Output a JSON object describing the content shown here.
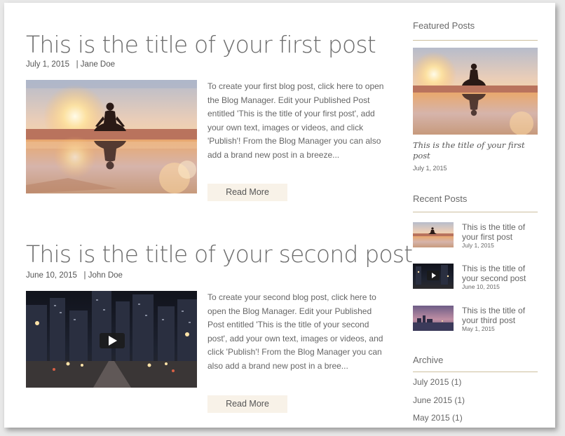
{
  "posts": [
    {
      "title": "This is the title of your first post",
      "date": "July 1, 2015",
      "author": "Jane Doe",
      "excerpt": "To create your first blog post, click here to open the Blog Manager.  Edit your Published Post entitled 'This is the title of your first post', add your own text, images or videos, and click 'Publish'! From the Blog Manager you can also add a brand new post in a breeze...",
      "read_more": "Read More",
      "image": "sunset-meditation-photo"
    },
    {
      "title": "This is the title of your second post",
      "date": "June 10, 2015",
      "author": "John Doe",
      "excerpt": "To create your second blog post, click here to open the Blog Manager.  Edit your Published Post entitled 'This is the title of your second post', add your own text, images or videos, and click 'Publish'! From the Blog Manager you can also add a brand new post in a bree...",
      "read_more": "Read More",
      "image": "night-city-video"
    }
  ],
  "sidebar": {
    "featured": {
      "heading": "Featured Posts",
      "title": "This is the title of your first post",
      "date": "July 1, 2015"
    },
    "recent": {
      "heading": "Recent Posts",
      "items": [
        {
          "title": "This is the title of your first post",
          "date": "July 1, 2015"
        },
        {
          "title": "This is the title of your second post",
          "date": "June 10, 2015"
        },
        {
          "title": "This is the title of your third post",
          "date": "May 1, 2015"
        }
      ]
    },
    "archive": {
      "heading": "Archive",
      "items": [
        "July 2015 (1)",
        "June 2015 (1)",
        "May 2015 (1)"
      ]
    }
  },
  "colors": {
    "rule": "#cdbf9e",
    "button_bg": "#f8f2e8",
    "title_text": "#6b6b6b"
  },
  "icons": [
    "play-icon"
  ]
}
